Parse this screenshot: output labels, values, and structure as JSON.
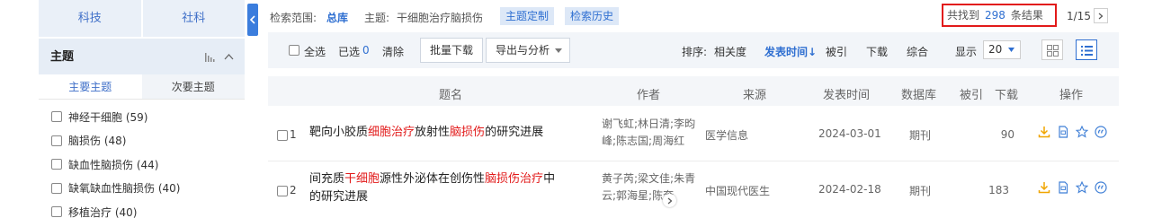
{
  "sidebar": {
    "top_tabs": [
      "科技",
      "社科"
    ],
    "facet_title": "主题",
    "sub_tabs": [
      "主要主题",
      "次要主题"
    ],
    "facets": [
      {
        "label": "神经干细胞 (59)"
      },
      {
        "label": "脑损伤 (48)"
      },
      {
        "label": "缺血性脑损伤 (44)"
      },
      {
        "label": "缺氧缺血性脑损伤 (40)"
      },
      {
        "label": "移植治疗 (40)"
      }
    ]
  },
  "scope": {
    "scope_label": "检索范围:",
    "scope_value": "总库",
    "topic_label": "主题:",
    "topic_value": "干细胞治疗脑损伤",
    "custom_btn": "主题定制",
    "history_btn": "检索历史",
    "found_prefix": "共找到",
    "found_count": "298",
    "found_suffix": "条结果",
    "page": "1/15"
  },
  "toolbar": {
    "select_all": "全选",
    "selected_label": "已选",
    "selected_count": "0",
    "clear": "清除",
    "batch_download": "批量下载",
    "export": "导出与分析",
    "sort_label": "排序:",
    "sort_options": [
      "相关度",
      "发表时间",
      "被引",
      "下载",
      "综合"
    ],
    "display_label": "显示",
    "page_size": "20"
  },
  "table": {
    "headers": [
      "题名",
      "作者",
      "来源",
      "发表时间",
      "数据库",
      "被引",
      "下载",
      "操作"
    ],
    "rows": [
      {
        "index": "1",
        "title_parts": [
          "靶向小胶质",
          "细胞治疗",
          "放射性",
          "脑损伤",
          "的研究进展"
        ],
        "author_line1": "谢飞虹;林日清;李昀",
        "author_line2": "峰;陈志国;周海红",
        "source": "医学信息",
        "date": "2024-03-01",
        "db": "期刊",
        "cited": "",
        "downloads": "90"
      },
      {
        "index": "2",
        "title_parts": [
          "间充质",
          "干细胞",
          "源性外泌体在创伤性",
          "脑损伤治疗",
          "中"
        ],
        "title_line2": "的研究进展",
        "author_line1": "黄子芮;梁文佳;朱青",
        "author_line2": "云;郭海星;陈奎",
        "source": "中国现代医生",
        "date": "2024-02-18",
        "db": "期刊",
        "cited": "",
        "downloads": "183"
      }
    ]
  }
}
